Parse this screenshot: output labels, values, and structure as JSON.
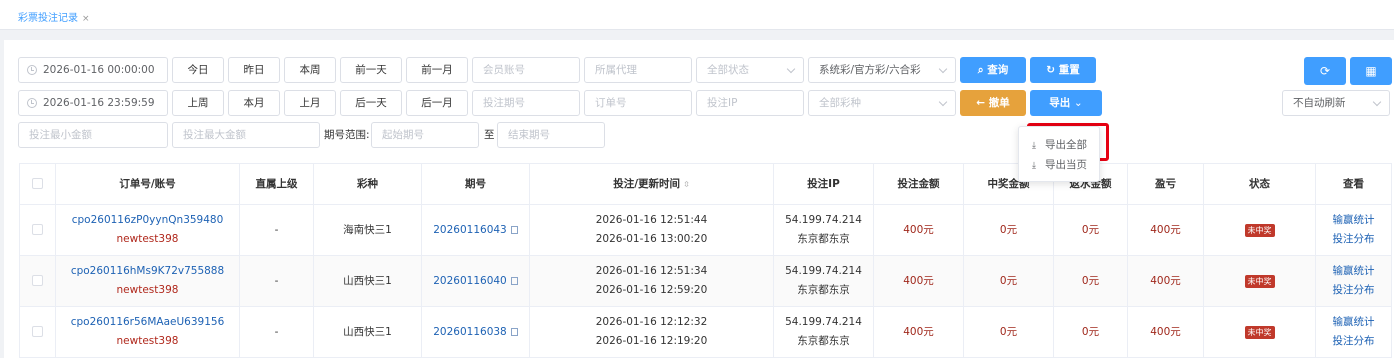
{
  "tab": {
    "title": "彩票投注记录",
    "close": "×"
  },
  "filters": {
    "start_date": "2026-01-16 00:00:00",
    "end_date": "2026-01-16 23:59:59",
    "quick1": [
      "今日",
      "昨日",
      "本周",
      "前一天",
      "前一月"
    ],
    "quick2": [
      "上周",
      "本月",
      "上月",
      "后一天",
      "后一月"
    ],
    "member_placeholder": "会员账号",
    "agent_placeholder": "所属代理",
    "status_placeholder": "全部状态",
    "lottery_type": "系统彩/官方彩/六合彩",
    "issue_placeholder": "投注期号",
    "order_placeholder": "订单号",
    "ip_placeholder": "投注IP",
    "game_placeholder": "全部彩种",
    "min_amount": "投注最小金额",
    "max_amount": "投注最大金额",
    "range_label": "期号范围:",
    "start_issue": "起始期号",
    "to": "至",
    "end_issue": "结束期号",
    "refresh_mode": "不自动刷新"
  },
  "buttons": {
    "query": "查询",
    "reset": "重置",
    "undo": "撤单",
    "export": "导出",
    "refresh_icon": "refresh-icon",
    "grid_icon": "grid-icon"
  },
  "export_menu": [
    "导出全部",
    "导出当页"
  ],
  "table": {
    "headers": [
      "订单号/账号",
      "直属上级",
      "彩种",
      "期号",
      "投注/更新时间",
      "投注IP",
      "投注金额",
      "中奖金额",
      "返水金额",
      "盈亏",
      "状态",
      "查看"
    ],
    "rows": [
      {
        "order": "cpo260116zP0yynQn359480",
        "account": "newtest398",
        "parent": "-",
        "game": "海南快三1",
        "issue": "20260116043",
        "bet_time": "2026-01-16 12:51:44",
        "update_time": "2026-01-16 13:00:20",
        "ip": "54.199.74.214",
        "ip_loc": "东京都东京",
        "amount": "400元",
        "win": "0元",
        "rebate": "0元",
        "profit": "400元",
        "status": "未中奖",
        "link1": "输赢统计",
        "link2": "投注分布"
      },
      {
        "order": "cpo260116hMs9K72v755888",
        "account": "newtest398",
        "parent": "-",
        "game": "山西快三1",
        "issue": "20260116040",
        "bet_time": "2026-01-16 12:51:34",
        "update_time": "2026-01-16 12:59:20",
        "ip": "54.199.74.214",
        "ip_loc": "东京都东京",
        "amount": "400元",
        "win": "0元",
        "rebate": "0元",
        "profit": "400元",
        "status": "未中奖",
        "link1": "输赢统计",
        "link2": "投注分布"
      },
      {
        "order": "cpo260116r56MAaeU639156",
        "account": "newtest398",
        "parent": "-",
        "game": "山西快三1",
        "issue": "20260116038",
        "bet_time": "2026-01-16 12:12:32",
        "update_time": "2026-01-16 12:19:20",
        "ip": "54.199.74.214",
        "ip_loc": "东京都东京",
        "amount": "400元",
        "win": "0元",
        "rebate": "0元",
        "profit": "400元",
        "status": "未中奖",
        "link1": "输赢统计",
        "link2": "投注分布"
      }
    ]
  }
}
